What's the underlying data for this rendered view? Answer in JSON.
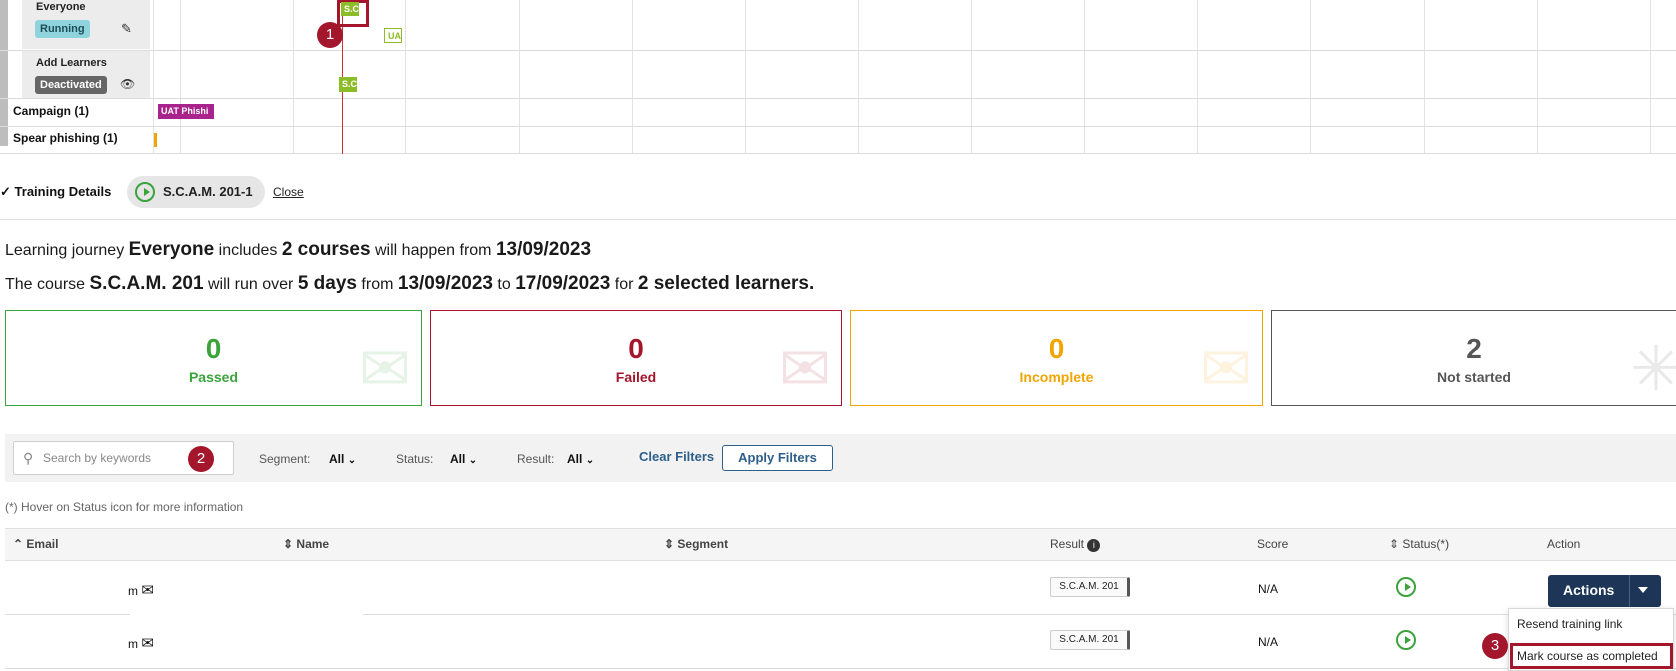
{
  "timeline": {
    "segments": [
      {
        "name": "Everyone",
        "status": "Running"
      },
      {
        "name": "Add Learners",
        "status": "Deactivated"
      }
    ],
    "rows": [
      {
        "label": "Campaign (1)"
      },
      {
        "label": "Spear phishing (1)"
      }
    ],
    "bars": {
      "everyone_top": "S.C",
      "everyone_uat": "UA",
      "add_learners": "S.C",
      "campaign": "UAT Phishi"
    }
  },
  "markers": {
    "m1": "1",
    "m2": "2",
    "m3": "3"
  },
  "training_details": {
    "title": "Training Details",
    "chip_label": "S.C.A.M. 201-1",
    "close_label": "Close"
  },
  "summary": {
    "s1_a": "Learning journey",
    "s1_journey": "Everyone",
    "s1_b": "includes",
    "s1_courses": "2 courses",
    "s1_c": "will happen from",
    "s1_date": "13/09/2023",
    "s2_a": "The course",
    "s2_course": "S.C.A.M. 201",
    "s2_b": "will run over",
    "s2_days": "5 days",
    "s2_c": "from",
    "s2_from": "13/09/2023",
    "s2_d": "to",
    "s2_to": "17/09/2023",
    "s2_e": "for",
    "s2_learners": "2 selected learners."
  },
  "stats": [
    {
      "value": "0",
      "label": "Passed",
      "color": "#3aa33a"
    },
    {
      "value": "0",
      "label": "Failed",
      "color": "#a3162b"
    },
    {
      "value": "0",
      "label": "Incomplete",
      "color": "#f0a500"
    },
    {
      "value": "2",
      "label": "Not started",
      "color": "#444444"
    }
  ],
  "filters": {
    "search_placeholder": "Search by keywords",
    "segment_label": "Segment:",
    "segment_value": "All",
    "status_label": "Status:",
    "status_value": "All",
    "result_label": "Result:",
    "result_value": "All",
    "clear_label": "Clear Filters",
    "apply_label": "Apply Filters"
  },
  "hint": "(*) Hover on Status icon for more information",
  "table": {
    "headers": {
      "email": "Email",
      "name": "Name",
      "segment": "Segment",
      "result": "Result",
      "score": "Score",
      "status": "Status(*)",
      "action": "Action"
    },
    "rows": [
      {
        "email_suffix": "m",
        "result": "S.C.A.M. 201",
        "score": "N/A"
      },
      {
        "email_suffix": "m",
        "result": "S.C.A.M. 201",
        "score": "N/A"
      }
    ],
    "actions_label": "Actions",
    "menu": [
      "Resend training link",
      "Mark course as completed"
    ]
  }
}
